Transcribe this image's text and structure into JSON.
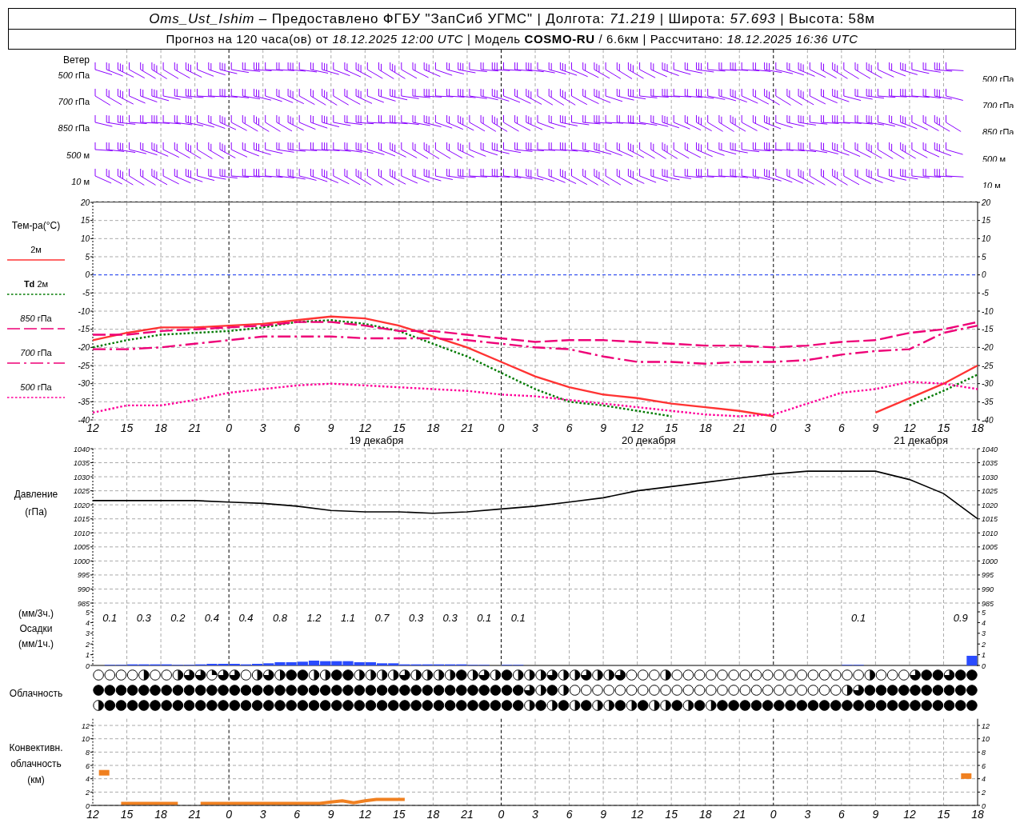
{
  "header": {
    "line_1": "*Oms_Ust_Ishim* – Предоставлено ФГБУ \"ЗапСиб УГМС\" | Долгота: *71.219* | Широта: *57.693* | Высота: 58м",
    "line_2": "Прогноз на 120 часа(ов) от *18.12.2025 12:00 UTC* | Модель **COSMO-RU** / 6.6км | Рассчитано: *18.12.2025 16:36 UTC*"
  },
  "wind": {
    "title": "Ветер",
    "levels_left": [
      "*500* гПа",
      "*700* гПа",
      "*850* гПа",
      "*500* м",
      "*10* м"
    ],
    "levels_right": [
      "*500* гПа",
      "*700* гПа",
      "*850* гПа",
      "*500* м",
      "*10* м"
    ]
  },
  "temperature": {
    "ylabel": "Тем-ра(°С)",
    "chart_data": {
      "type": "line",
      "grid": true,
      "ref_lines": [
        {
          "axis": "y",
          "value": 0,
          "color": "#2244ff"
        }
      ],
      "categories": [
        "12",
        "15",
        "18",
        "21",
        "0",
        "3",
        "6",
        "9",
        "12",
        "15",
        "18",
        "21",
        "0",
        "3",
        "6",
        "9",
        "12",
        "15",
        "18",
        "21",
        "0",
        "3",
        "6",
        "9",
        "12",
        "15",
        "18"
      ],
      "ylim": [
        -40,
        20
      ],
      "yticks": [
        20,
        15,
        10,
        5,
        0,
        -5,
        -10,
        -15,
        -20,
        -25,
        -30,
        -35,
        -40
      ],
      "series": [
        {
          "name": "2м",
          "color": "#ff3333",
          "line_style": "solid",
          "values": [
            -18,
            -16,
            -14.5,
            -14.5,
            -14,
            -13.5,
            -12.5,
            -11.5,
            -12,
            -14,
            -17,
            -20,
            -24,
            -28,
            -31,
            -33,
            -34,
            -35.5,
            -36.5,
            -37.5,
            -39,
            null,
            null,
            -38,
            -34,
            -30,
            -25
          ]
        },
        {
          "name": "**Td** 2м",
          "color": "#007a00",
          "line_style": "dotted",
          "values": [
            -20,
            -18,
            -16.5,
            -16,
            -15.5,
            -14.5,
            -13,
            -12.5,
            -13.5,
            -15.5,
            -19,
            -22.5,
            -27,
            -31.5,
            -35,
            -36,
            -37.5,
            -39,
            null,
            null,
            null,
            null,
            null,
            null,
            -36,
            -32,
            -27.5
          ]
        },
        {
          "name": "*850* гПа",
          "color": "#ee0077",
          "line_style": "dashed",
          "values": [
            -16.5,
            -16.5,
            -15.5,
            -15,
            -14.5,
            -14,
            -13,
            -13,
            -14,
            -15.5,
            -15.5,
            -16.5,
            -17.5,
            -18.5,
            -18,
            -18,
            -18.5,
            -19,
            -19.5,
            -19.5,
            -20,
            -19.5,
            -18.5,
            -18,
            -16,
            -15,
            -13
          ]
        },
        {
          "name": "*700* гПа",
          "color": "#ee0077",
          "line_style": "dashdot",
          "values": [
            -20.5,
            -20.5,
            -20,
            -19,
            -18,
            -17,
            -17,
            -17,
            -17.5,
            -17.5,
            -17.5,
            -18,
            -19,
            -20,
            -20.5,
            -22.5,
            -24,
            -24,
            -24.5,
            -24,
            -24,
            -23.5,
            -22,
            -21,
            -20.5,
            -16,
            -14
          ]
        },
        {
          "name": "*500* гПа",
          "color": "#ff0099",
          "line_style": "dotted",
          "values": [
            -38,
            -36,
            -36,
            -34.5,
            -32.5,
            -31.5,
            -30.5,
            -30,
            -30.5,
            -31,
            -31.5,
            -32,
            -33,
            -33.5,
            -34.5,
            -35.5,
            -36.5,
            -37.5,
            -38.5,
            -39,
            -38.5,
            -35.5,
            -32.5,
            -31.5,
            -29.5,
            -30,
            -31.5
          ]
        }
      ]
    },
    "right_ticks": [
      "20",
      "15",
      "10",
      "5",
      "0",
      "-5",
      "-10",
      "-15",
      "-20",
      "-25",
      "-30",
      "-35",
      "-40"
    ],
    "dates": [
      {
        "text": "19 декабря"
      },
      {
        "text": "20 декабря"
      },
      {
        "text": "21 декабря"
      }
    ]
  },
  "pressure": {
    "labels": [
      "Давление",
      "(гПа)"
    ],
    "chart_data": {
      "type": "line",
      "grid": true,
      "ylim": [
        985,
        1040
      ],
      "yticks": [
        1040,
        1035,
        1030,
        1025,
        1020,
        1015,
        1010,
        1005,
        1000,
        995,
        990,
        985
      ],
      "series": [
        {
          "color": "#000000",
          "values": [
            1021.5,
            1021.5,
            1021.5,
            1021.5,
            1021,
            1020.5,
            1019.5,
            1018,
            1017.5,
            1017.5,
            1017,
            1017.5,
            1018.5,
            1019.5,
            1021,
            1022.5,
            1025,
            1026.5,
            1028,
            1029.5,
            1031,
            1032,
            1032,
            1032,
            1029,
            1024,
            1015
          ]
        }
      ]
    },
    "right_ticks": [
      "1040",
      "1035",
      "1030",
      "1025",
      "1020",
      "1015",
      "1010",
      "1005",
      "1000",
      "995",
      "990",
      "985"
    ]
  },
  "precipitation": {
    "labels": [
      "(мм/3ч.)",
      "Осадки",
      "(мм/1ч.)"
    ],
    "chart_data": {
      "type": "bar",
      "grid": true,
      "ylim": [
        0,
        5
      ],
      "yticks": [
        5,
        4,
        3,
        2,
        1,
        0
      ],
      "values": [
        0,
        0.05,
        0.05,
        0.1,
        0.1,
        0.1,
        0.1,
        0.05,
        0.05,
        0.1,
        0.15,
        0.15,
        0.15,
        0.1,
        0.15,
        0.2,
        0.3,
        0.3,
        0.35,
        0.45,
        0.4,
        0.4,
        0.4,
        0.3,
        0.3,
        0.2,
        0.2,
        0.1,
        0.1,
        0.1,
        0.1,
        0.1,
        0.1,
        0.05,
        0.05,
        0,
        0.05,
        0.05,
        0,
        0,
        0,
        0,
        0,
        0,
        0,
        0,
        0,
        0,
        0,
        0,
        0,
        0,
        0,
        0,
        0,
        0,
        0,
        0,
        0,
        0,
        0,
        0,
        0,
        0,
        0,
        0,
        0.05,
        0.05,
        0,
        0,
        0,
        0,
        0,
        0,
        0,
        0,
        0,
        0.9
      ]
    },
    "right_ticks": [
      "5",
      "4",
      "3",
      "2",
      "1",
      "0"
    ],
    "totals": [
      {
        "text": "0.1"
      },
      {
        "text": "0.3"
      },
      {
        "text": "0.2"
      },
      {
        "text": "0.4"
      },
      {
        "text": "0.4"
      },
      {
        "text": "0.8"
      },
      {
        "text": "1.2"
      },
      {
        "text": "1.1"
      },
      {
        "text": "0.7"
      },
      {
        "text": "0.3"
      },
      {
        "text": "0.3"
      },
      {
        "text": "0.1"
      },
      {
        "text": "0.1"
      },
      {
        "text": "0.1"
      },
      {
        "text": "0.9"
      }
    ]
  },
  "clouds": {
    "label": "Облачность",
    "rows": [
      {
        "cells": [
          {
            "kind": "clear"
          },
          {
            "kind": "clear"
          },
          {
            "kind": "clear"
          },
          {
            "kind": "clear"
          },
          {
            "kind": "half"
          },
          {
            "kind": "clear"
          },
          {
            "kind": "clear"
          },
          {
            "kind": "half"
          },
          {
            "kind": "most"
          },
          {
            "kind": "most"
          },
          {
            "kind": "few"
          },
          {
            "kind": "most"
          },
          {
            "kind": "most"
          },
          {
            "kind": "clear"
          },
          {
            "kind": "half"
          },
          {
            "kind": "most"
          },
          {
            "kind": "half"
          },
          {
            "kind": "overcast"
          },
          {
            "kind": "overcast"
          },
          {
            "kind": "half"
          },
          {
            "kind": "half"
          },
          {
            "kind": "overcast"
          },
          {
            "kind": "overcast"
          },
          {
            "kind": "half"
          },
          {
            "kind": "half"
          },
          {
            "kind": "half"
          },
          {
            "kind": "half"
          },
          {
            "kind": "most"
          },
          {
            "kind": "half"
          },
          {
            "kind": "half"
          },
          {
            "kind": "half"
          },
          {
            "kind": "half"
          },
          {
            "kind": "overcast"
          },
          {
            "kind": "half"
          },
          {
            "kind": "most"
          },
          {
            "kind": "half"
          },
          {
            "kind": "overcast"
          },
          {
            "kind": "half"
          },
          {
            "kind": "half"
          },
          {
            "kind": "half"
          },
          {
            "kind": "most"
          },
          {
            "kind": "half"
          },
          {
            "kind": "half"
          },
          {
            "kind": "most"
          },
          {
            "kind": "half"
          },
          {
            "kind": "half"
          },
          {
            "kind": "most"
          },
          {
            "kind": "clear"
          },
          {
            "kind": "clear"
          },
          {
            "kind": "clear"
          },
          {
            "kind": "half"
          },
          {
            "kind": "clear"
          },
          {
            "kind": "clear"
          },
          {
            "kind": "clear"
          },
          {
            "kind": "clear"
          },
          {
            "kind": "clear"
          },
          {
            "kind": "clear"
          },
          {
            "kind": "clear"
          },
          {
            "kind": "clear"
          },
          {
            "kind": "clear"
          },
          {
            "kind": "clear"
          },
          {
            "kind": "clear"
          },
          {
            "kind": "clear"
          },
          {
            "kind": "clear"
          },
          {
            "kind": "clear"
          },
          {
            "kind": "clear"
          },
          {
            "kind": "clear"
          },
          {
            "kind": "clear"
          },
          {
            "kind": "half"
          },
          {
            "kind": "clear"
          },
          {
            "kind": "clear"
          },
          {
            "kind": "clear"
          },
          {
            "kind": "most"
          },
          {
            "kind": "overcast"
          },
          {
            "kind": "overcast"
          },
          {
            "kind": "most"
          },
          {
            "kind": "overcast"
          },
          {
            "kind": "overcast"
          }
        ]
      },
      {
        "cells": [
          {
            "kind": "overcast"
          },
          {
            "kind": "overcast"
          },
          {
            "kind": "overcast"
          },
          {
            "kind": "overcast"
          },
          {
            "kind": "overcast"
          },
          {
            "kind": "overcast"
          },
          {
            "kind": "overcast"
          },
          {
            "kind": "overcast"
          },
          {
            "kind": "overcast"
          },
          {
            "kind": "overcast"
          },
          {
            "kind": "overcast"
          },
          {
            "kind": "overcast"
          },
          {
            "kind": "overcast"
          },
          {
            "kind": "overcast"
          },
          {
            "kind": "overcast"
          },
          {
            "kind": "overcast"
          },
          {
            "kind": "overcast"
          },
          {
            "kind": "overcast"
          },
          {
            "kind": "overcast"
          },
          {
            "kind": "overcast"
          },
          {
            "kind": "overcast"
          },
          {
            "kind": "overcast"
          },
          {
            "kind": "overcast"
          },
          {
            "kind": "overcast"
          },
          {
            "kind": "overcast"
          },
          {
            "kind": "overcast"
          },
          {
            "kind": "overcast"
          },
          {
            "kind": "overcast"
          },
          {
            "kind": "overcast"
          },
          {
            "kind": "overcast"
          },
          {
            "kind": "overcast"
          },
          {
            "kind": "overcast"
          },
          {
            "kind": "overcast"
          },
          {
            "kind": "overcast"
          },
          {
            "kind": "overcast"
          },
          {
            "kind": "overcast"
          },
          {
            "kind": "overcast"
          },
          {
            "kind": "overcast"
          },
          {
            "kind": "most"
          },
          {
            "kind": "half"
          },
          {
            "kind": "overcast"
          },
          {
            "kind": "half"
          },
          {
            "kind": "clear"
          },
          {
            "kind": "clear"
          },
          {
            "kind": "clear"
          },
          {
            "kind": "clear"
          },
          {
            "kind": "clear"
          },
          {
            "kind": "clear"
          },
          {
            "kind": "clear"
          },
          {
            "kind": "clear"
          },
          {
            "kind": "clear"
          },
          {
            "kind": "clear"
          },
          {
            "kind": "clear"
          },
          {
            "kind": "clear"
          },
          {
            "kind": "clear"
          },
          {
            "kind": "clear"
          },
          {
            "kind": "clear"
          },
          {
            "kind": "clear"
          },
          {
            "kind": "clear"
          },
          {
            "kind": "clear"
          },
          {
            "kind": "clear"
          },
          {
            "kind": "clear"
          },
          {
            "kind": "clear"
          },
          {
            "kind": "clear"
          },
          {
            "kind": "clear"
          },
          {
            "kind": "clear"
          },
          {
            "kind": "half"
          },
          {
            "kind": "most"
          },
          {
            "kind": "overcast"
          },
          {
            "kind": "overcast"
          },
          {
            "kind": "overcast"
          },
          {
            "kind": "overcast"
          },
          {
            "kind": "overcast"
          },
          {
            "kind": "overcast"
          },
          {
            "kind": "overcast"
          },
          {
            "kind": "overcast"
          },
          {
            "kind": "overcast"
          },
          {
            "kind": "overcast"
          }
        ]
      },
      {
        "cells": [
          {
            "kind": "half"
          },
          {
            "kind": "overcast"
          },
          {
            "kind": "overcast"
          },
          {
            "kind": "overcast"
          },
          {
            "kind": "overcast"
          },
          {
            "kind": "overcast"
          },
          {
            "kind": "overcast"
          },
          {
            "kind": "overcast"
          },
          {
            "kind": "overcast"
          },
          {
            "kind": "overcast"
          },
          {
            "kind": "overcast"
          },
          {
            "kind": "overcast"
          },
          {
            "kind": "overcast"
          },
          {
            "kind": "overcast"
          },
          {
            "kind": "overcast"
          },
          {
            "kind": "overcast"
          },
          {
            "kind": "overcast"
          },
          {
            "kind": "overcast"
          },
          {
            "kind": "overcast"
          },
          {
            "kind": "overcast"
          },
          {
            "kind": "overcast"
          },
          {
            "kind": "overcast"
          },
          {
            "kind": "overcast"
          },
          {
            "kind": "overcast"
          },
          {
            "kind": "overcast"
          },
          {
            "kind": "overcast"
          },
          {
            "kind": "overcast"
          },
          {
            "kind": "overcast"
          },
          {
            "kind": "overcast"
          },
          {
            "kind": "overcast"
          },
          {
            "kind": "overcast"
          },
          {
            "kind": "overcast"
          },
          {
            "kind": "overcast"
          },
          {
            "kind": "overcast"
          },
          {
            "kind": "overcast"
          },
          {
            "kind": "overcast"
          },
          {
            "kind": "overcast"
          },
          {
            "kind": "overcast"
          },
          {
            "kind": "half"
          },
          {
            "kind": "overcast"
          },
          {
            "kind": "half"
          },
          {
            "kind": "overcast"
          },
          {
            "kind": "half"
          },
          {
            "kind": "overcast"
          },
          {
            "kind": "half"
          },
          {
            "kind": "half"
          },
          {
            "kind": "overcast"
          },
          {
            "kind": "half"
          },
          {
            "kind": "overcast"
          },
          {
            "kind": "half"
          },
          {
            "kind": "half"
          },
          {
            "kind": "overcast"
          },
          {
            "kind": "half"
          },
          {
            "kind": "overcast"
          },
          {
            "kind": "half"
          },
          {
            "kind": "overcast"
          },
          {
            "kind": "overcast"
          },
          {
            "kind": "overcast"
          },
          {
            "kind": "overcast"
          },
          {
            "kind": "overcast"
          },
          {
            "kind": "overcast"
          },
          {
            "kind": "overcast"
          },
          {
            "kind": "overcast"
          },
          {
            "kind": "overcast"
          },
          {
            "kind": "overcast"
          },
          {
            "kind": "overcast"
          },
          {
            "kind": "overcast"
          },
          {
            "kind": "overcast"
          },
          {
            "kind": "overcast"
          },
          {
            "kind": "overcast"
          },
          {
            "kind": "overcast"
          },
          {
            "kind": "overcast"
          },
          {
            "kind": "overcast"
          },
          {
            "kind": "overcast"
          },
          {
            "kind": "overcast"
          },
          {
            "kind": "overcast"
          },
          {
            "kind": "overcast"
          },
          {
            "kind": "overcast"
          }
        ]
      }
    ]
  },
  "convective": {
    "labels": [
      "Конвективн.",
      "облачность",
      "(км)"
    ],
    "chart_data": {
      "type": "line",
      "grid": true,
      "ylim": [
        0,
        13
      ],
      "yticks": [
        12,
        10,
        8,
        6,
        4,
        2,
        0
      ],
      "categories": [
        "12",
        null,
        null,
        "15",
        null,
        null,
        "18",
        null,
        null,
        "21",
        null,
        null,
        "0",
        null,
        null,
        "3",
        null,
        null,
        "6",
        null,
        null,
        "9",
        null,
        null,
        "12",
        null,
        null,
        "15",
        null,
        null,
        "18",
        null,
        null,
        "21",
        null,
        null,
        "0",
        null,
        null,
        "3",
        null,
        null,
        "6",
        null,
        null,
        "9",
        null,
        null,
        "12",
        null,
        null,
        "15",
        null,
        null,
        "18",
        null,
        null,
        "21",
        null,
        null,
        "0",
        null,
        null,
        "3",
        null,
        null,
        "6",
        null,
        null,
        "9",
        null,
        null,
        "12",
        null,
        null,
        "15",
        null,
        null,
        "18"
      ],
      "series": [
        {
          "color": "#f08020",
          "values": [
            null,
            4.9,
            null,
            0.3,
            0.3,
            0.3,
            0.3,
            0.3,
            null,
            null,
            0.3,
            0.3,
            0.3,
            0.3,
            0.3,
            0.3,
            0.3,
            0.3,
            0.3,
            0.3,
            0.3,
            0.5,
            0.7,
            0.4,
            0.7,
            0.9,
            0.9,
            0.9,
            null,
            null,
            null,
            null,
            null,
            null,
            null,
            null,
            null,
            null,
            null,
            null,
            null,
            null,
            null,
            null,
            null,
            null,
            null,
            null,
            null,
            null,
            null,
            null,
            null,
            null,
            null,
            null,
            null,
            null,
            null,
            null,
            null,
            null,
            null,
            null,
            null,
            null,
            null,
            null,
            null,
            null,
            null,
            null,
            null,
            null,
            null,
            null,
            null,
            4.4,
            null
          ]
        }
      ]
    },
    "right_ticks": [
      "12",
      "10",
      "8",
      "6",
      "4",
      "2",
      "0"
    ]
  }
}
